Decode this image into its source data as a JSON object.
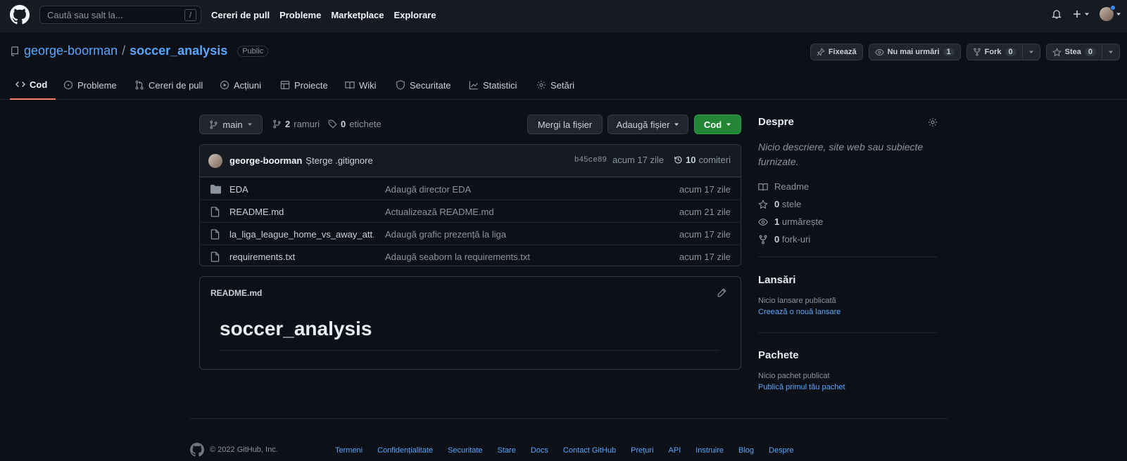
{
  "colors": {
    "accent": "#58a6ff",
    "green": "#238636",
    "tab_underline": "#f78166",
    "bg": "#0d1117"
  },
  "topnav": {
    "search_placeholder": "Caută sau salt la...",
    "search_key": "/",
    "links": [
      "Cereri de pull",
      "Probleme",
      "Marketplace",
      "Explorare"
    ]
  },
  "repo": {
    "owner": "george-boorman",
    "separator": "/",
    "name": "soccer_analysis",
    "visibility": "Public",
    "actions": {
      "pin_label": "Fixează",
      "unwatch_label": "Nu mai urmări",
      "watch_count": "1",
      "fork_label": "Fork",
      "fork_count": "0",
      "star_label": "Stea",
      "star_count": "0"
    }
  },
  "tabs": [
    {
      "label": "Cod",
      "icon": "code-icon",
      "active": true
    },
    {
      "label": "Probleme",
      "icon": "issue-icon"
    },
    {
      "label": "Cereri de pull",
      "icon": "pull-request-icon"
    },
    {
      "label": "Acțiuni",
      "icon": "play-icon"
    },
    {
      "label": "Proiecte",
      "icon": "table-icon"
    },
    {
      "label": "Wiki",
      "icon": "book-icon"
    },
    {
      "label": "Securitate",
      "icon": "shield-icon"
    },
    {
      "label": "Statistici",
      "icon": "graph-icon"
    },
    {
      "label": "Setări",
      "icon": "gear-icon"
    }
  ],
  "branch_bar": {
    "branch": "main",
    "branches_count": "2",
    "branches_label": "ramuri",
    "tags_count": "0",
    "tags_label": "etichete",
    "go_to_file": "Mergi la fișier",
    "add_file": "Adaugă fișier",
    "code": "Cod"
  },
  "latest_commit": {
    "author": "george-boorman",
    "message": "Șterge .gitignore",
    "sha": "b45ce89",
    "age": "acum 17 zile",
    "commits_count": "10",
    "commits_label": "comiteri"
  },
  "files": [
    {
      "type": "folder",
      "name": "EDA",
      "commit": "Adaugă director EDA",
      "age": "acum 17 zile"
    },
    {
      "type": "file",
      "name": "README.md",
      "commit": "Actualizează README.md",
      "age": "acum 21 zile"
    },
    {
      "type": "file",
      "name": "la_liga_league_home_vs_away_att...",
      "commit": "Adaugă grafic prezență la liga",
      "age": "acum 17 zile"
    },
    {
      "type": "file",
      "name": "requirements.txt",
      "commit": "Adaugă seaborn la requirements.txt",
      "age": "acum 17 zile"
    }
  ],
  "readme": {
    "filename": "README.md",
    "heading": "soccer_analysis"
  },
  "sidebar": {
    "about_title": "Despre",
    "about_desc": "Nicio descriere, site web sau subiecte furnizate.",
    "readme_label": "Readme",
    "stars_count": "0",
    "stars_label": "stele",
    "watching_count": "1",
    "watching_label": "urmărește",
    "forks_count": "0",
    "forks_label": "fork-uri",
    "releases_title": "Lansări",
    "releases_none": "Nicio lansare publicată",
    "releases_link": "Creează o nouă lansare",
    "packages_title": "Pachete",
    "packages_none": "Nicio pachet publicat",
    "packages_link": "Publică primul tău pachet"
  },
  "footer": {
    "copyright": "© 2022 GitHub, Inc.",
    "links": [
      "Termeni",
      "Confidențialitate",
      "Securitate",
      "Stare",
      "Docs",
      "Contact GitHub",
      "Prețuri",
      "API",
      "Instruire",
      "Blog",
      "Despre"
    ]
  }
}
